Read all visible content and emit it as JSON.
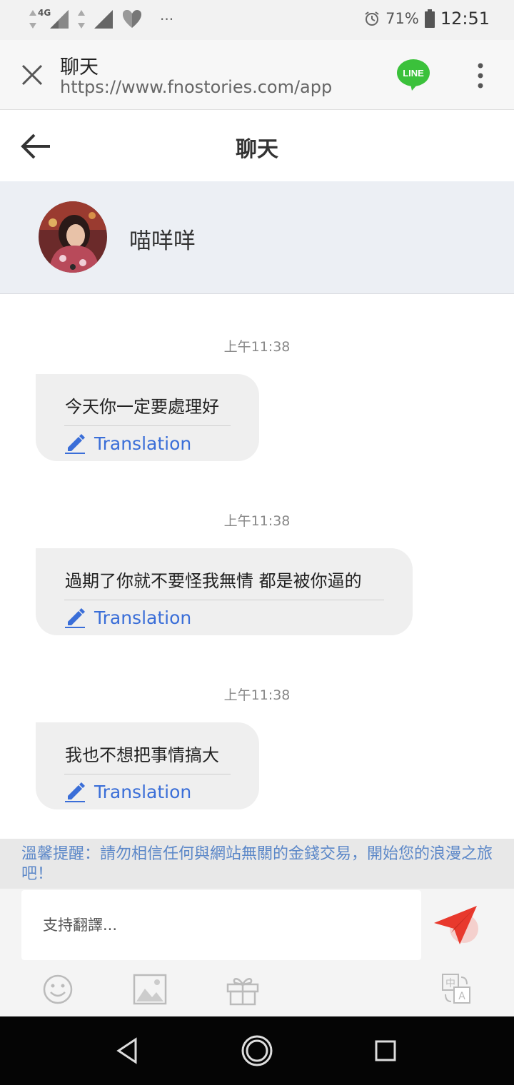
{
  "status_bar": {
    "network": "4G",
    "dots": "···",
    "battery": "71%",
    "time": "12:51"
  },
  "browser": {
    "title": "聊天",
    "url": "https://www.fnostories.com/app",
    "line_logo_text": "LINE"
  },
  "header": {
    "title": "聊天"
  },
  "profile": {
    "name": "喵咩咩"
  },
  "messages": [
    {
      "time": "上午11:38",
      "text": "今天你一定要處理好",
      "translate_label": "Translation"
    },
    {
      "time": "上午11:38",
      "text": "過期了你就不要怪我無情 都是被你逼的",
      "translate_label": "Translation"
    },
    {
      "time": "上午11:38",
      "text": "我也不想把事情搞大",
      "translate_label": "Translation"
    }
  ],
  "warning": "溫馨提醒：請勿相信任何與網站無關的金錢交易，開始您的浪漫之旅吧！",
  "input": {
    "placeholder": "支持翻譯..."
  },
  "toolbar_icons": [
    "emoji-icon",
    "image-icon",
    "gift-icon",
    "translate-icon"
  ],
  "colors": {
    "accent_blue": "#3a6ed8",
    "send_red": "#e8392d",
    "line_green": "#3bc13b",
    "warning_text": "#5b87c8"
  }
}
